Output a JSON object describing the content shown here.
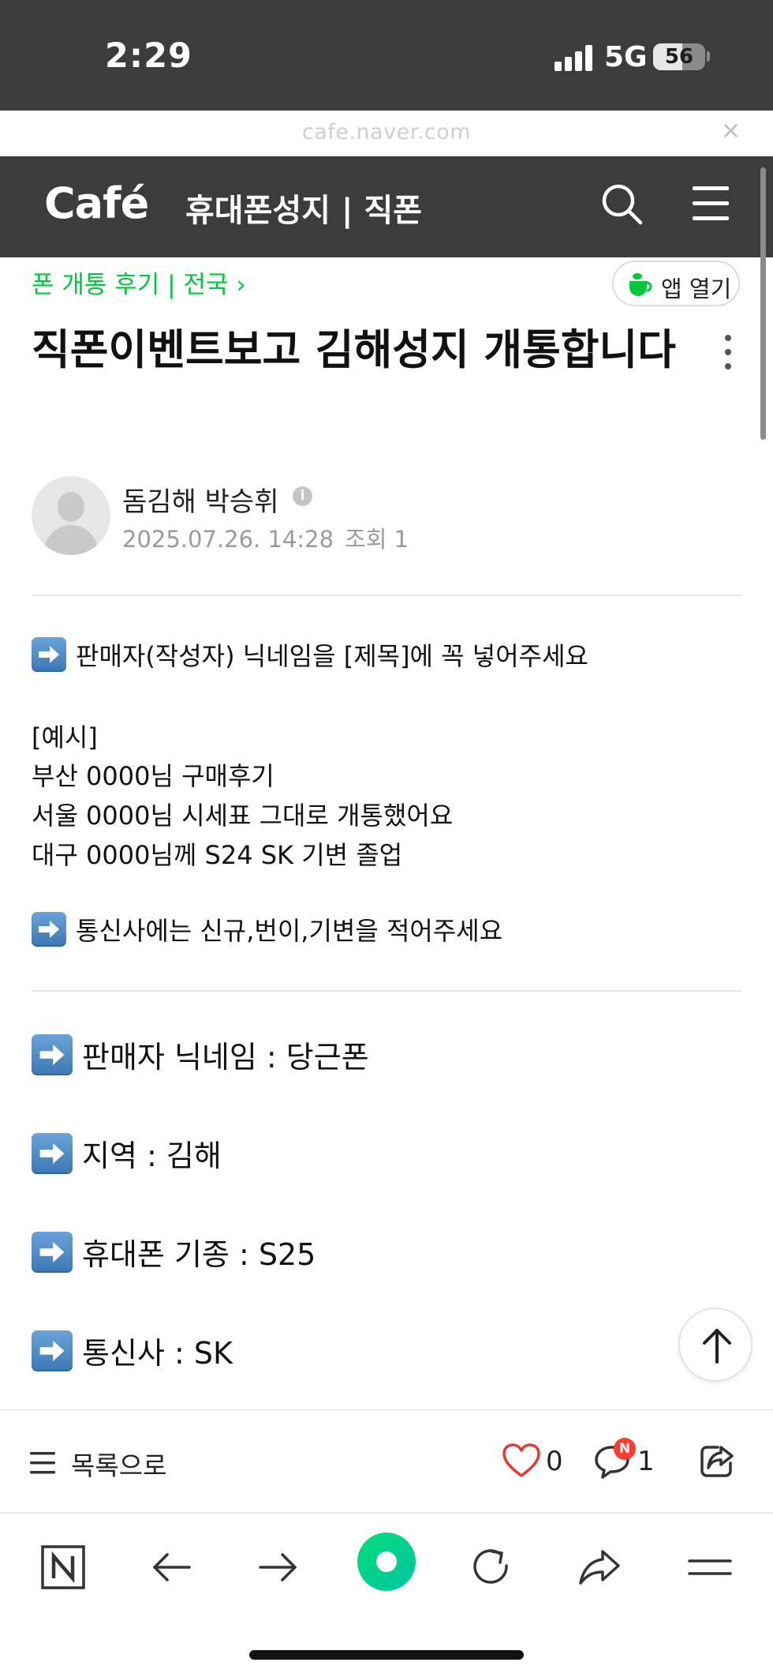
{
  "status_bar": {
    "time": "2:29",
    "network": "5G",
    "battery": "56",
    "battery_level": 0.56
  },
  "browser": {
    "url": "cafe.naver.com",
    "close_symbol": "×"
  },
  "cafe_header": {
    "logo": "Café",
    "title": "휴대폰성지 | 직폰",
    "accent_color": "#00c73c"
  },
  "article": {
    "breadcrumb": "폰 개통 후기 | 전국 ›",
    "app_open_label": "앱 열기",
    "title": "직폰이벤트보고 김해성지 개통합니다",
    "author": "돔김해 박승휘",
    "date": "2025.07.26. 14:28",
    "views": "조회 1"
  },
  "body": {
    "notice1": "판매자(작성자) 닉네임을 [제목]에 꼭 넣어주세요",
    "example_header": "[예시]",
    "example_1": "부산 0000님 구매후기",
    "example_2": "서울 0000님 시세표 그대로 개통했어요",
    "example_3": "대구 0000님께 S24 SK 기변 졸업",
    "notice2": "통신사에는 신규,번이,기변을 적어주세요",
    "seller": "판매자 닉네임 :  당근폰",
    "region": "지역 :  김해",
    "model": "휴대폰 기종 :  S25",
    "carrier": "통신사 :  SK"
  },
  "action_bar": {
    "list_label": "목록으로",
    "likes": "0",
    "comments": "1",
    "new_badge": "N"
  }
}
